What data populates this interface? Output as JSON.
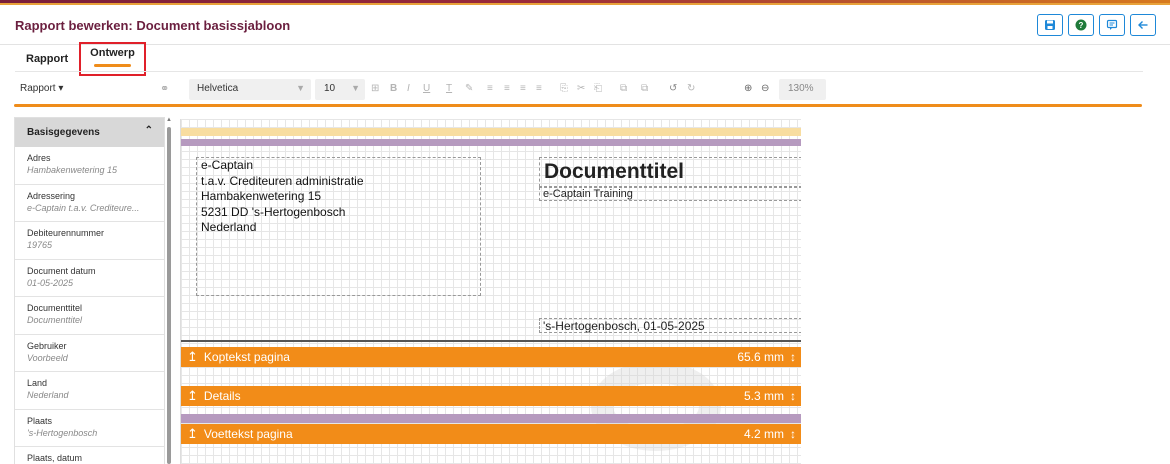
{
  "header": {
    "title": "Rapport bewerken: Document basissjabloon",
    "buttons": [
      "save-icon",
      "help-icon",
      "preview-icon",
      "back-icon"
    ]
  },
  "tabs": [
    {
      "label": "Rapport",
      "active": false
    },
    {
      "label": "Ontwerp",
      "active": true
    }
  ],
  "toolbar": {
    "menu_label": "Rapport ▾",
    "font": "Helvetica",
    "size": "10",
    "zoom": "130%"
  },
  "sidebar": {
    "section": "Basisgegevens",
    "items": [
      {
        "label": "Adres",
        "value": "Hambakenwetering 15"
      },
      {
        "label": "Adressering",
        "value": "e-Captain t.a.v. Crediteure..."
      },
      {
        "label": "Debiteurennummer",
        "value": "19765"
      },
      {
        "label": "Document datum",
        "value": "01-05-2025"
      },
      {
        "label": "Documenttitel",
        "value": "Documenttitel"
      },
      {
        "label": "Gebruiker",
        "value": "Voorbeeld"
      },
      {
        "label": "Land",
        "value": "Nederland"
      },
      {
        "label": "Plaats",
        "value": "'s-Hertogenbosch"
      },
      {
        "label": "Plaats, datum",
        "value": ""
      }
    ]
  },
  "canvas": {
    "address_lines": [
      "e-Captain",
      "t.a.v. Crediteuren administratie",
      "Hambakenwetering 15",
      "5231 DD 's-Hertogenbosch",
      "Nederland"
    ],
    "doc_title": "Documenttitel",
    "subtitle": "e-Captain Training",
    "place_date": "'s-Hertogenbosch, 01-05-2025",
    "sections": [
      {
        "label": "Koptekst pagina",
        "height": "65.6 mm"
      },
      {
        "label": "Details",
        "height": "5.3 mm"
      },
      {
        "label": "Voettekst pagina",
        "height": "4.2 mm"
      }
    ]
  },
  "colors": {
    "accent": "#f28c18",
    "title": "#6b1f3f",
    "button_border": "#1e88d8"
  }
}
